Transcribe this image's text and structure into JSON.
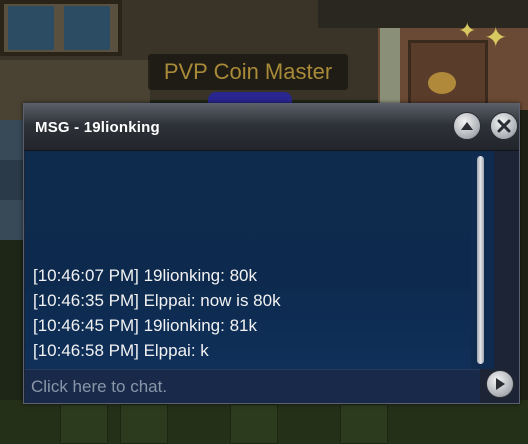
{
  "npc": {
    "name_tag": "PVP Coin Master"
  },
  "chat_window": {
    "title": "MSG - 19lionking",
    "messages": [
      "[10:46:07 PM] 19lionking: 80k",
      "[10:46:35 PM] Elppai: now is 80k",
      "[10:46:45 PM] 19lionking: 81k",
      "[10:46:58 PM] Elppai: k"
    ],
    "input_placeholder": "Click here to chat.",
    "icons": {
      "collapse": "chevron-up-icon",
      "close": "close-icon",
      "send": "play-arrow-icon"
    }
  }
}
